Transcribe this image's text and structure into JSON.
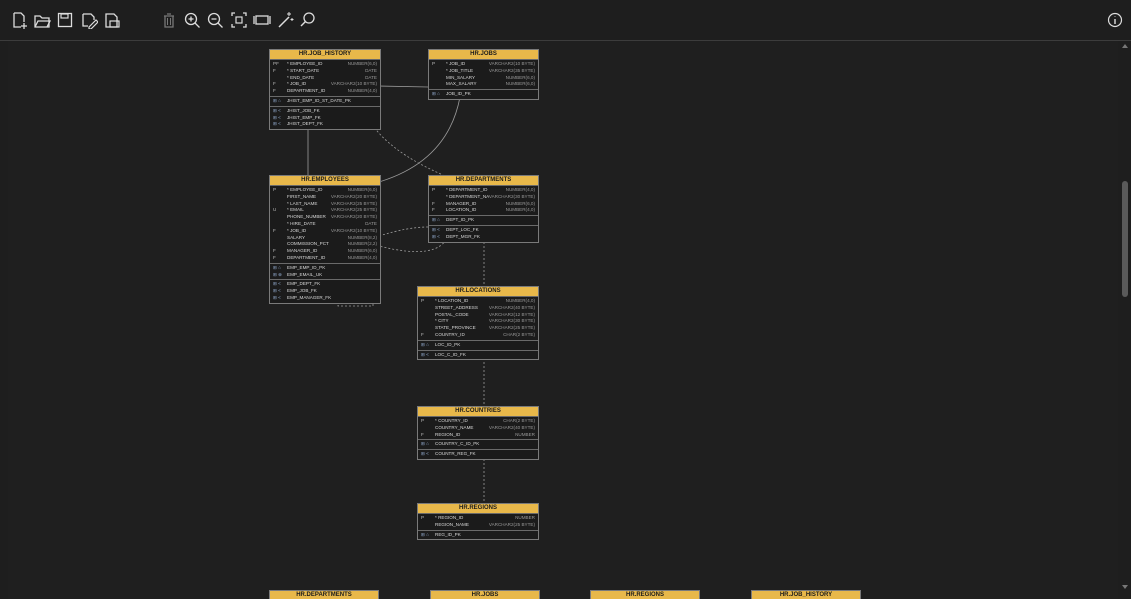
{
  "toolbar": {
    "buttons": [
      {
        "name": "new-diagram-icon",
        "type": "new"
      },
      {
        "name": "open-diagram-icon",
        "type": "open"
      },
      {
        "name": "save-icon",
        "type": "save"
      },
      {
        "name": "edit-icon",
        "type": "edit"
      },
      {
        "name": "export-image-icon",
        "type": "export"
      },
      {
        "name": "delete-icon",
        "type": "delete"
      },
      {
        "name": "zoom-in-icon",
        "type": "zoomin"
      },
      {
        "name": "zoom-out-icon",
        "type": "zoomout"
      },
      {
        "name": "fit-screen-icon",
        "type": "fit"
      },
      {
        "name": "actual-size-icon",
        "type": "actual"
      },
      {
        "name": "auto-layout-icon",
        "type": "magic"
      },
      {
        "name": "search-icon",
        "type": "search"
      }
    ],
    "info_icon": "info-icon"
  },
  "tables": [
    {
      "id": "job_history",
      "name": "HR.JOB_HISTORY",
      "columns": [
        {
          "key": "PF",
          "name": "* EMPLOYEE_ID",
          "type": "NUMBER(6,0)"
        },
        {
          "key": "F",
          "name": "* START_DATE",
          "type": "DATE"
        },
        {
          "key": "",
          "name": "* END_DATE",
          "type": "DATE"
        },
        {
          "key": "F",
          "name": "* JOB_ID",
          "type": "VARCHAR2(10 BYTE)"
        },
        {
          "key": "F",
          "name": "DEPARTMENT_ID",
          "type": "NUMBER(4,0)"
        }
      ],
      "indexes": [
        {
          "key": "⊞ ⌂",
          "name": "JHIST_EMP_ID_ST_DATE_PK"
        }
      ],
      "constraints": [
        {
          "key": "⊞ <",
          "name": "JHIST_JOB_FK"
        },
        {
          "key": "⊞ <",
          "name": "JHIST_EMP_FK"
        },
        {
          "key": "⊞ <",
          "name": "JHIST_DEPT_FK"
        }
      ]
    },
    {
      "id": "jobs",
      "name": "HR.JOBS",
      "columns": [
        {
          "key": "P",
          "name": "* JOB_ID",
          "type": "VARCHAR2(10 BYTE)"
        },
        {
          "key": "",
          "name": "* JOB_TITLE",
          "type": "VARCHAR2(35 BYTE)"
        },
        {
          "key": "",
          "name": "MIN_SALARY",
          "type": "NUMBER(6,0)"
        },
        {
          "key": "",
          "name": "MAX_SALARY",
          "type": "NUMBER(6,0)"
        }
      ],
      "indexes": [
        {
          "key": "⊞ ⌂",
          "name": "JOB_ID_PK"
        }
      ],
      "constraints": []
    },
    {
      "id": "employees",
      "name": "HR.EMPLOYEES",
      "columns": [
        {
          "key": "P",
          "name": "* EMPLOYEE_ID",
          "type": "NUMBER(6,0)"
        },
        {
          "key": "",
          "name": "FIRST_NAME",
          "type": "VARCHAR2(20 BYTE)"
        },
        {
          "key": "",
          "name": "* LAST_NAME",
          "type": "VARCHAR2(25 BYTE)"
        },
        {
          "key": "U",
          "name": "* EMAIL",
          "type": "VARCHAR2(25 BYTE)"
        },
        {
          "key": "",
          "name": "PHONE_NUMBER",
          "type": "VARCHAR2(20 BYTE)"
        },
        {
          "key": "",
          "name": "* HIRE_DATE",
          "type": "DATE"
        },
        {
          "key": "F",
          "name": "* JOB_ID",
          "type": "VARCHAR2(10 BYTE)"
        },
        {
          "key": "",
          "name": "SALARY",
          "type": "NUMBER(8,2)"
        },
        {
          "key": "",
          "name": "COMMISSION_PCT",
          "type": "NUMBER(2,2)"
        },
        {
          "key": "F",
          "name": "MANAGER_ID",
          "type": "NUMBER(6,0)"
        },
        {
          "key": "F",
          "name": "DEPARTMENT_ID",
          "type": "NUMBER(4,0)"
        }
      ],
      "indexes": [
        {
          "key": "⊞ ⌂",
          "name": "EMP_EMP_ID_PK"
        },
        {
          "key": "⊞ ⊕",
          "name": "EMP_EMAIL_UK"
        }
      ],
      "constraints": [
        {
          "key": "⊞ <",
          "name": "EMP_DEPT_FK"
        },
        {
          "key": "⊞ <",
          "name": "EMP_JOB_FK"
        },
        {
          "key": "⊞ <",
          "name": "EMP_MANAGER_FK"
        }
      ]
    },
    {
      "id": "departments",
      "name": "HR.DEPARTMENTS",
      "columns": [
        {
          "key": "P",
          "name": "* DEPARTMENT_ID",
          "type": "NUMBER(4,0)"
        },
        {
          "key": "",
          "name": "* DEPARTMENT_NAME",
          "type": "VARCHAR2(30 BYTE)"
        },
        {
          "key": "F",
          "name": "MANAGER_ID",
          "type": "NUMBER(6,0)"
        },
        {
          "key": "F",
          "name": "LOCATION_ID",
          "type": "NUMBER(4,0)"
        }
      ],
      "indexes": [
        {
          "key": "⊞ ⌂",
          "name": "DEPT_ID_PK"
        }
      ],
      "constraints": [
        {
          "key": "⊞ <",
          "name": "DEPT_LOC_FK"
        },
        {
          "key": "⊞ <",
          "name": "DEPT_MGR_FK"
        }
      ]
    },
    {
      "id": "locations",
      "name": "HR.LOCATIONS",
      "columns": [
        {
          "key": "P",
          "name": "* LOCATION_ID",
          "type": "NUMBER(4,0)"
        },
        {
          "key": "",
          "name": "STREET_ADDRESS",
          "type": "VARCHAR2(40 BYTE)"
        },
        {
          "key": "",
          "name": "POSTAL_CODE",
          "type": "VARCHAR2(12 BYTE)"
        },
        {
          "key": "",
          "name": "* CITY",
          "type": "VARCHAR2(30 BYTE)"
        },
        {
          "key": "",
          "name": "STATE_PROVINCE",
          "type": "VARCHAR2(25 BYTE)"
        },
        {
          "key": "F",
          "name": "COUNTRY_ID",
          "type": "CHAR(2 BYTE)"
        }
      ],
      "indexes": [
        {
          "key": "⊞ ⌂",
          "name": "LOC_ID_PK"
        }
      ],
      "constraints": [
        {
          "key": "⊞ <",
          "name": "LOC_C_ID_FK"
        }
      ]
    },
    {
      "id": "countries",
      "name": "HR.COUNTRIES",
      "columns": [
        {
          "key": "P",
          "name": "* COUNTRY_ID",
          "type": "CHAR(2 BYTE)"
        },
        {
          "key": "",
          "name": "COUNTRY_NAME",
          "type": "VARCHAR2(40 BYTE)"
        },
        {
          "key": "F",
          "name": "REGION_ID",
          "type": "NUMBER"
        }
      ],
      "indexes": [
        {
          "key": "⊞ ⌂",
          "name": "COUNTRY_C_ID_PK"
        }
      ],
      "constraints": [
        {
          "key": "⊞ <",
          "name": "COUNTR_REG_FK"
        }
      ]
    },
    {
      "id": "regions",
      "name": "HR.REGIONS",
      "columns": [
        {
          "key": "P",
          "name": "* REGION_ID",
          "type": "NUMBER"
        },
        {
          "key": "",
          "name": "REGION_NAME",
          "type": "VARCHAR2(25 BYTE)"
        }
      ],
      "indexes": [
        {
          "key": "⊞ ⌂",
          "name": "REG_ID_PK"
        }
      ],
      "constraints": []
    }
  ],
  "bottom_tables": [
    "HR.DEPARTMENTS",
    "HR.JOBS",
    "HR.REGIONS",
    "HR.JOB_HISTORY"
  ]
}
